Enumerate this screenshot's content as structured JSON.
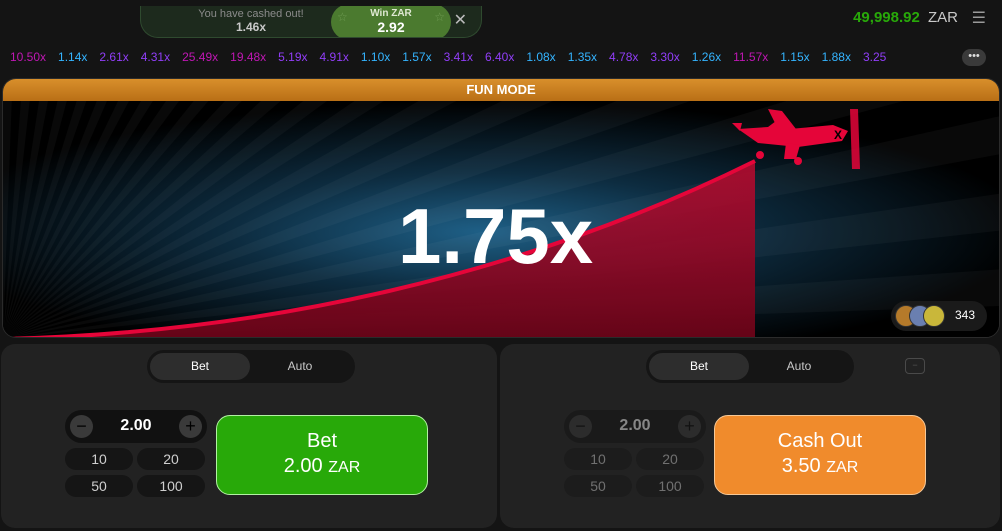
{
  "toast": {
    "message": "You have cashed out!",
    "multiplier": "1.46x",
    "win_label": "Win ZAR",
    "win_amount": "2.92",
    "close_icon": "close-icon"
  },
  "balance": {
    "value": "49,998.92",
    "currency": "ZAR"
  },
  "menu_icon": "hamburger-menu-icon",
  "history": [
    {
      "value": "10.50x",
      "color": "#c017b4"
    },
    {
      "value": "1.14x",
      "color": "#34b4ff"
    },
    {
      "value": "2.61x",
      "color": "#913ef8"
    },
    {
      "value": "4.31x",
      "color": "#913ef8"
    },
    {
      "value": "25.49x",
      "color": "#c017b4"
    },
    {
      "value": "19.48x",
      "color": "#c017b4"
    },
    {
      "value": "5.19x",
      "color": "#913ef8"
    },
    {
      "value": "4.91x",
      "color": "#913ef8"
    },
    {
      "value": "1.10x",
      "color": "#34b4ff"
    },
    {
      "value": "1.57x",
      "color": "#34b4ff"
    },
    {
      "value": "3.41x",
      "color": "#913ef8"
    },
    {
      "value": "6.40x",
      "color": "#913ef8"
    },
    {
      "value": "1.08x",
      "color": "#34b4ff"
    },
    {
      "value": "1.35x",
      "color": "#34b4ff"
    },
    {
      "value": "4.78x",
      "color": "#913ef8"
    },
    {
      "value": "3.30x",
      "color": "#913ef8"
    },
    {
      "value": "1.26x",
      "color": "#34b4ff"
    },
    {
      "value": "11.57x",
      "color": "#c017b4"
    },
    {
      "value": "1.15x",
      "color": "#34b4ff"
    },
    {
      "value": "1.88x",
      "color": "#34b4ff"
    },
    {
      "value": "3.25",
      "color": "#913ef8"
    }
  ],
  "more_label": "•••",
  "game": {
    "mode_label": "FUN MODE",
    "multiplier": "1.75x",
    "players_count": "343",
    "curve_color": "#e50539",
    "plane_color": "#e50539"
  },
  "panel1": {
    "tabs": [
      "Bet",
      "Auto"
    ],
    "amount": "2.00",
    "quick": [
      "10",
      "20",
      "50",
      "100"
    ],
    "button_line1": "Bet",
    "button_amount": "2.00",
    "button_currency": "ZAR"
  },
  "panel2": {
    "tabs": [
      "Bet",
      "Auto"
    ],
    "amount": "2.00",
    "quick": [
      "10",
      "20",
      "50",
      "100"
    ],
    "button_line1": "Cash Out",
    "button_amount": "3.50",
    "button_currency": "ZAR"
  },
  "colors": {
    "accent_green": "#28a909",
    "cashout_orange": "#f08b2c",
    "fun_mode_orange": "#d88f2b"
  }
}
